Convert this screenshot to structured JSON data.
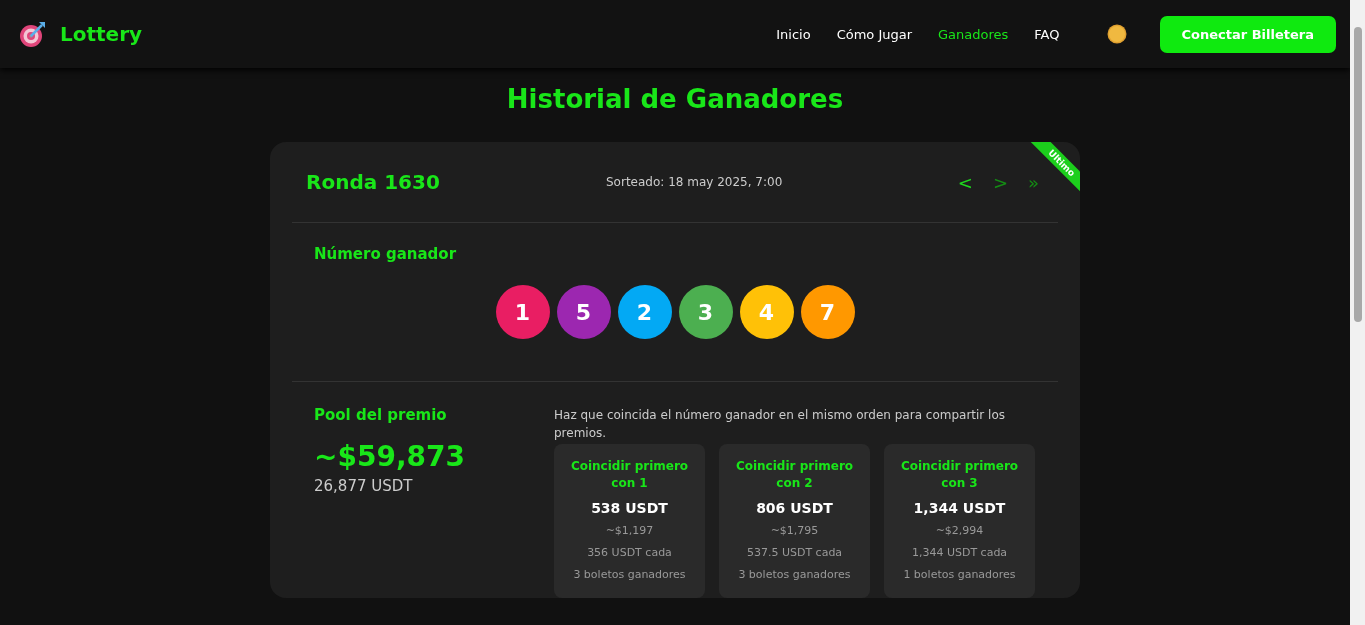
{
  "brand": {
    "name": "Lottery"
  },
  "nav": [
    {
      "label": "Inicio",
      "selected": false
    },
    {
      "label": "Cómo Jugar",
      "selected": false
    },
    {
      "label": "Ganadores",
      "selected": true
    },
    {
      "label": "FAQ",
      "selected": false
    }
  ],
  "connect_button": "Conectar Billetera",
  "page_title": "Historial de Ganadores",
  "round": {
    "ribbon": "Ultimo",
    "title": "Ronda 1630",
    "drawn": "Sorteado: 18 may 2025, 7:00",
    "pager": [
      {
        "label": "<",
        "disabled": false
      },
      {
        "label": ">",
        "disabled": true
      },
      {
        "label": "»",
        "disabled": true
      }
    ]
  },
  "winning": {
    "heading": "Número ganador",
    "balls": [
      {
        "digit": "1",
        "color": "#e91e63"
      },
      {
        "digit": "5",
        "color": "#9c27b0"
      },
      {
        "digit": "2",
        "color": "#03a9f4"
      },
      {
        "digit": "3",
        "color": "#4caf50"
      },
      {
        "digit": "4",
        "color": "#ffc107"
      },
      {
        "digit": "7",
        "color": "#ff9800"
      }
    ]
  },
  "pool": {
    "heading": "Pool del premio",
    "usd": "~$59,873",
    "usdt": "26,877 USDT"
  },
  "prizes": {
    "note": "Haz que coincida el número ganador en el mismo orden para compartir los premios.",
    "cards": [
      {
        "title": "Coincidir primero con 1",
        "amount": "538 USDT",
        "usd": "~$1,197",
        "each": "356 USDT cada",
        "tickets": "3 boletos ganadores"
      },
      {
        "title": "Coincidir primero con 2",
        "amount": "806 USDT",
        "usd": "~$1,795",
        "each": "537.5 USDT cada",
        "tickets": "3 boletos ganadores"
      },
      {
        "title": "Coincidir primero con 3",
        "amount": "1,344 USDT",
        "usd": "~$2,994",
        "each": "1,344 USDT cada",
        "tickets": "1 boletos ganadores"
      }
    ]
  }
}
